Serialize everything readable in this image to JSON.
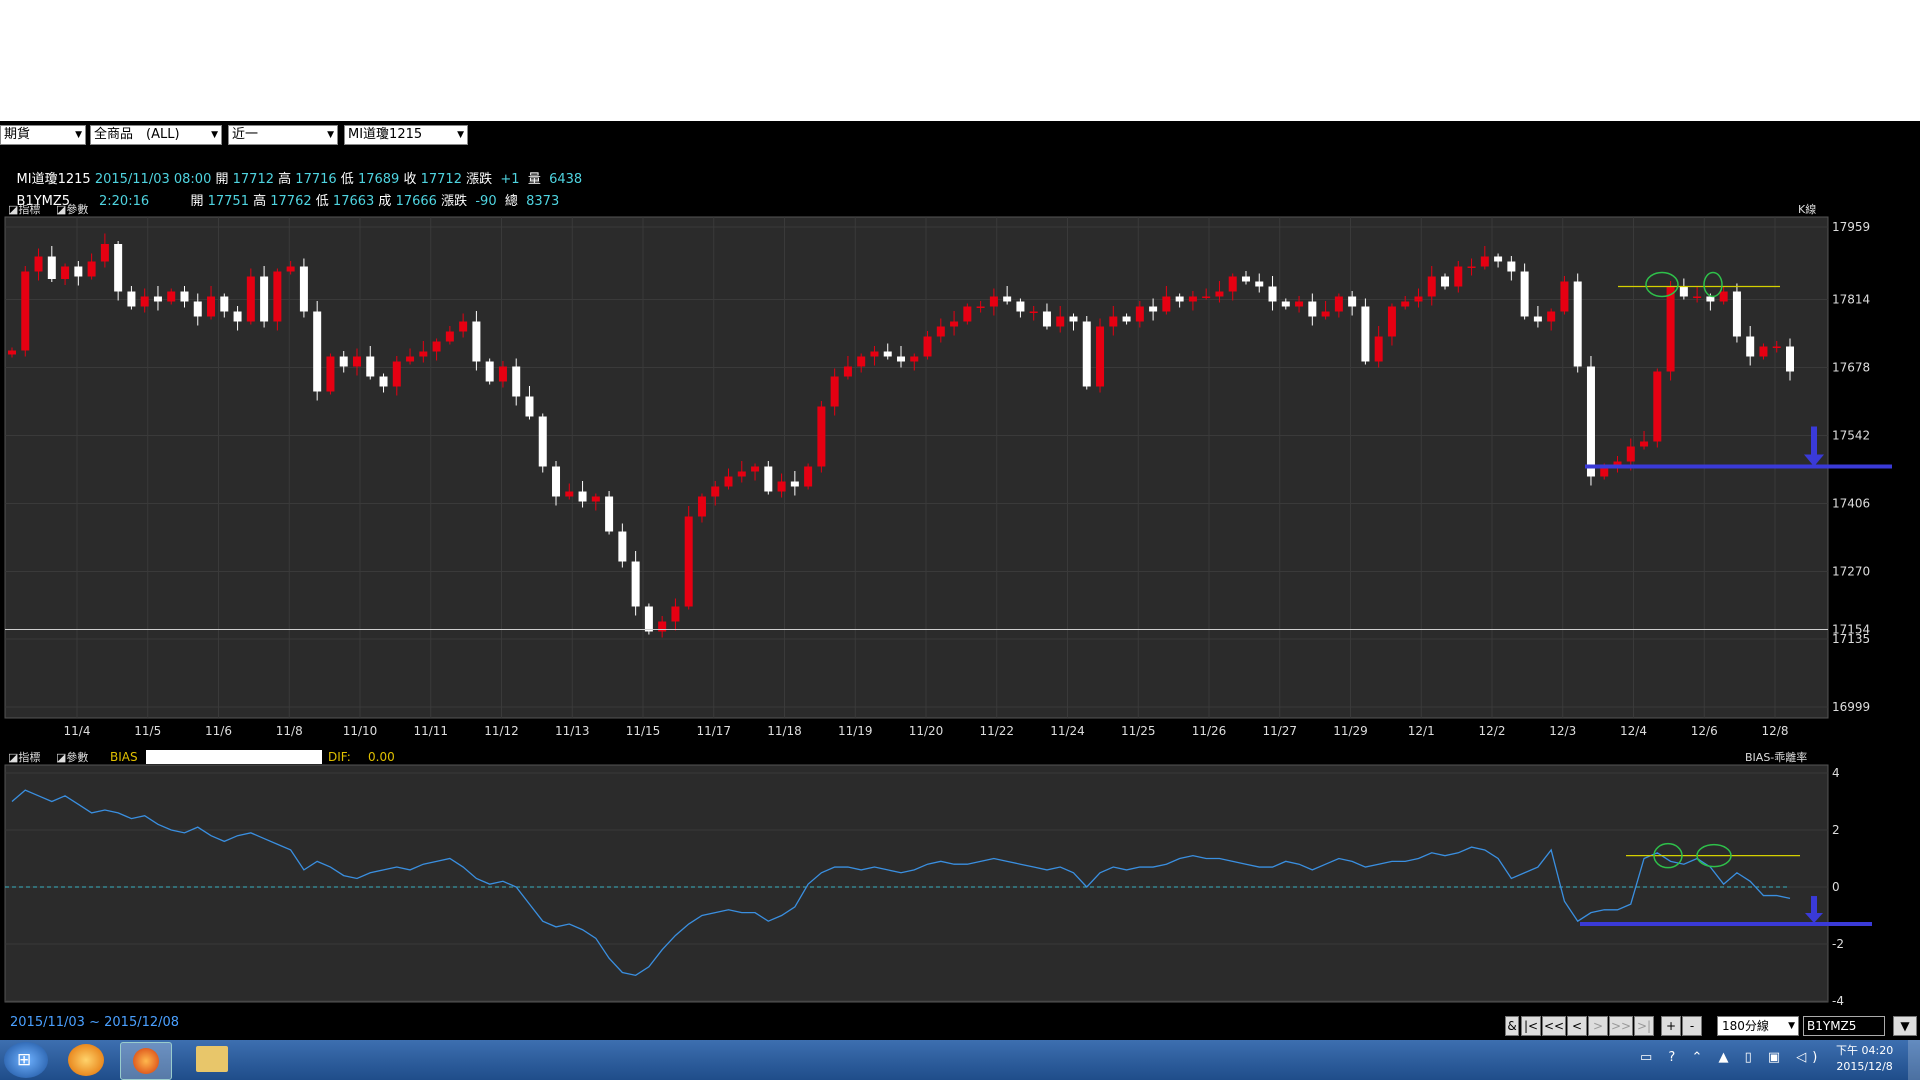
{
  "selectors": {
    "market": "期貨",
    "product": "全商品　(ALL)",
    "period": "近一",
    "contract": "MI道瓊1215"
  },
  "quotes": [
    {
      "name": "MI道瓊1215",
      "time": "2015/11/03 08:00",
      "open_label": "開",
      "open": "17712",
      "high_label": "高",
      "high": "17716",
      "low_label": "低",
      "low": "17689",
      "close_label": "收",
      "close": "17712",
      "chg_label": "漲跌",
      "chg": "+1",
      "vol_label": "量",
      "vol": "6438"
    },
    {
      "name": "B1YMZ5",
      "time": "2:20:16",
      "open_label": "開",
      "open": "17751",
      "high_label": "高",
      "high": "17762",
      "low_label": "低",
      "low": "17663",
      "close_label": "成",
      "close": "17666",
      "chg_label": "漲跌",
      "chg": "-90",
      "vol_label": "總",
      "vol": "8373"
    }
  ],
  "main_panel": {
    "tab1": "指標",
    "tab2": "參數",
    "type_label": "K線"
  },
  "sub_panel": {
    "tab1": "指標",
    "tab2": "參數",
    "indicator": "BIAS",
    "dif_label": "DIF:",
    "dif_value": "0.00",
    "type_label": "BIAS-乖離率"
  },
  "date_range": {
    "start": "2015/11/03",
    "sep": "~",
    "end": "2015/12/08"
  },
  "toolbar": {
    "amp": "&",
    "first": "|<",
    "prev_fast": "<<",
    "prev": "<",
    "next": ">",
    "next_fast": ">>",
    "last": ">|",
    "zoom_in": "+",
    "zoom_out": "-",
    "interval": "180分線",
    "symbol": "B1YMZ5"
  },
  "clock": {
    "time": "下午 04:20",
    "date": "2015/12/8"
  },
  "colors": {
    "up": "#e60012",
    "down": "#ffffff",
    "bias_line": "#3a8fe0",
    "support": "#3a3ad8",
    "resistance": "#d4d000",
    "grid": "#3a3a3a"
  },
  "chart_data": [
    {
      "type": "candlestick",
      "title": "MI道瓊1215",
      "ylim": [
        16999,
        17959
      ],
      "yticks": [
        17959,
        17814,
        17678,
        17542,
        17406,
        17270,
        17154,
        17135,
        16999
      ],
      "date_labels": [
        "11/4",
        "11/5",
        "11/6",
        "11/8",
        "11/10",
        "11/11",
        "11/12",
        "11/13",
        "11/15",
        "11/17",
        "11/18",
        "11/19",
        "11/20",
        "11/22",
        "11/24",
        "11/25",
        "11/26",
        "11/27",
        "11/29",
        "12/1",
        "12/2",
        "12/3",
        "12/4",
        "12/6",
        "12/8"
      ],
      "closes": [
        17712,
        17870,
        17900,
        17855,
        17880,
        17860,
        17890,
        17925,
        17830,
        17800,
        17820,
        17810,
        17830,
        17810,
        17780,
        17820,
        17790,
        17770,
        17860,
        17770,
        17870,
        17880,
        17790,
        17630,
        17700,
        17680,
        17700,
        17660,
        17640,
        17690,
        17700,
        17710,
        17730,
        17750,
        17770,
        17690,
        17650,
        17680,
        17620,
        17580,
        17480,
        17420,
        17430,
        17410,
        17420,
        17350,
        17290,
        17200,
        17150,
        17170,
        17200,
        17380,
        17420,
        17440,
        17460,
        17470,
        17480,
        17430,
        17450,
        17440,
        17480,
        17600,
        17660,
        17680,
        17700,
        17710,
        17700,
        17690,
        17700,
        17740,
        17760,
        17770,
        17800,
        17800,
        17820,
        17810,
        17790,
        17790,
        17760,
        17780,
        17770,
        17640,
        17760,
        17780,
        17770,
        17800,
        17790,
        17820,
        17810,
        17820,
        17820,
        17830,
        17860,
        17850,
        17840,
        17810,
        17800,
        17810,
        17780,
        17790,
        17820,
        17800,
        17690,
        17740,
        17800,
        17810,
        17820,
        17860,
        17840,
        17880,
        17880,
        17900,
        17890,
        17870,
        17780,
        17770,
        17790,
        17850,
        17680,
        17460,
        17480,
        17490,
        17520,
        17530,
        17670,
        17840,
        17820,
        17820,
        17810,
        17830,
        17740,
        17700,
        17720,
        17720,
        17670
      ],
      "line_levels": {
        "support": 17480,
        "resistance": 17840,
        "session_line": 17154
      },
      "volume": null
    },
    {
      "type": "line",
      "title": "BIAS-乖離率",
      "ylim": [
        -4,
        4
      ],
      "yticks": [
        4,
        2,
        0,
        -2,
        -4
      ],
      "series": [
        {
          "name": "BIAS",
          "values": [
            3.0,
            3.4,
            3.2,
            3.0,
            3.2,
            2.9,
            2.6,
            2.7,
            2.6,
            2.4,
            2.5,
            2.2,
            2.0,
            1.9,
            2.1,
            1.8,
            1.6,
            1.8,
            1.9,
            1.7,
            1.5,
            1.3,
            0.6,
            0.9,
            0.7,
            0.4,
            0.3,
            0.5,
            0.6,
            0.7,
            0.6,
            0.8,
            0.9,
            1.0,
            0.7,
            0.3,
            0.1,
            0.2,
            0.0,
            -0.6,
            -1.2,
            -1.4,
            -1.3,
            -1.5,
            -1.8,
            -2.5,
            -3.0,
            -3.1,
            -2.8,
            -2.2,
            -1.7,
            -1.3,
            -1.0,
            -0.9,
            -0.8,
            -0.9,
            -0.9,
            -1.2,
            -1.0,
            -0.7,
            0.1,
            0.5,
            0.7,
            0.7,
            0.6,
            0.7,
            0.6,
            0.5,
            0.6,
            0.8,
            0.9,
            0.8,
            0.8,
            0.9,
            1.0,
            0.9,
            0.8,
            0.7,
            0.6,
            0.7,
            0.5,
            0.0,
            0.5,
            0.7,
            0.6,
            0.7,
            0.7,
            0.8,
            1.0,
            1.1,
            1.0,
            1.0,
            0.9,
            0.8,
            0.7,
            0.7,
            0.9,
            0.8,
            0.6,
            0.8,
            1.0,
            0.9,
            0.7,
            0.8,
            0.9,
            0.9,
            1.0,
            1.2,
            1.1,
            1.2,
            1.4,
            1.3,
            1.0,
            0.3,
            0.5,
            0.7,
            1.3,
            -0.5,
            -1.2,
            -0.9,
            -0.8,
            -0.8,
            -0.6,
            1.0,
            1.2,
            0.9,
            0.8,
            1.0,
            0.7,
            0.1,
            0.5,
            0.2,
            -0.3,
            -0.3,
            -0.4
          ]
        }
      ],
      "line_levels": {
        "support": -1.3,
        "resistance": 1.1
      }
    }
  ]
}
